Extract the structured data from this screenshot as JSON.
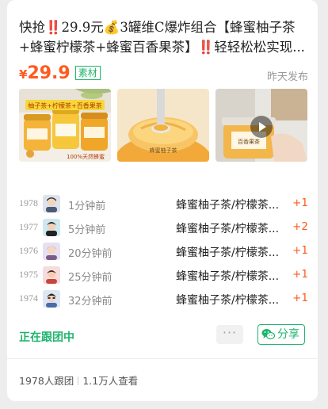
{
  "post": {
    "title_line1": "快抢‼️29.9元💰3罐维C爆炸组合【蜂蜜柚子茶",
    "title_line2": "+蜂蜜柠檬茶+蜂蜜百香果茶】‼️轻轻松松实现...",
    "fire_icon": "fire-icon",
    "price_symbol": "¥",
    "price_value": "29.9",
    "material_tag": "素材",
    "published": "昨天发布"
  },
  "images": [
    {
      "name": "product-photo-1",
      "overlay_text": "柚子茶+柠檬茶+百香果茶",
      "bottom_text": "100%天然蜂蜜"
    },
    {
      "name": "product-photo-2",
      "overlay_text": "蜂蜜柚子茶"
    },
    {
      "name": "product-video-3",
      "overlay_text": "百香果茶",
      "icon": "play-icon"
    }
  ],
  "orders": [
    {
      "num": "1978",
      "time": "1分钟前",
      "item": "蜂蜜柚子茶/柠檬茶...",
      "count": "+1"
    },
    {
      "num": "1977",
      "time": "5分钟前",
      "item": "蜂蜜柚子茶/柠檬茶...",
      "count": "+2"
    },
    {
      "num": "1976",
      "time": "20分钟前",
      "item": "蜂蜜柚子茶/柠檬茶...",
      "count": "+1"
    },
    {
      "num": "1975",
      "time": "25分钟前",
      "item": "蜂蜜柚子茶/柠檬茶...",
      "count": "+1"
    },
    {
      "num": "1974",
      "time": "32分钟前",
      "item": "蜂蜜柚子茶/柠檬茶...",
      "count": "+1"
    }
  ],
  "actions": {
    "status": "正在跟团中",
    "more_label": "···",
    "share_label": "分享",
    "share_icon": "wechat-icon"
  },
  "footer": {
    "joined": "1978人跟团",
    "views": "1.1万人查看"
  },
  "colors": {
    "accent_green": "#1fb46d",
    "price_orange": "#ff5a1f"
  }
}
